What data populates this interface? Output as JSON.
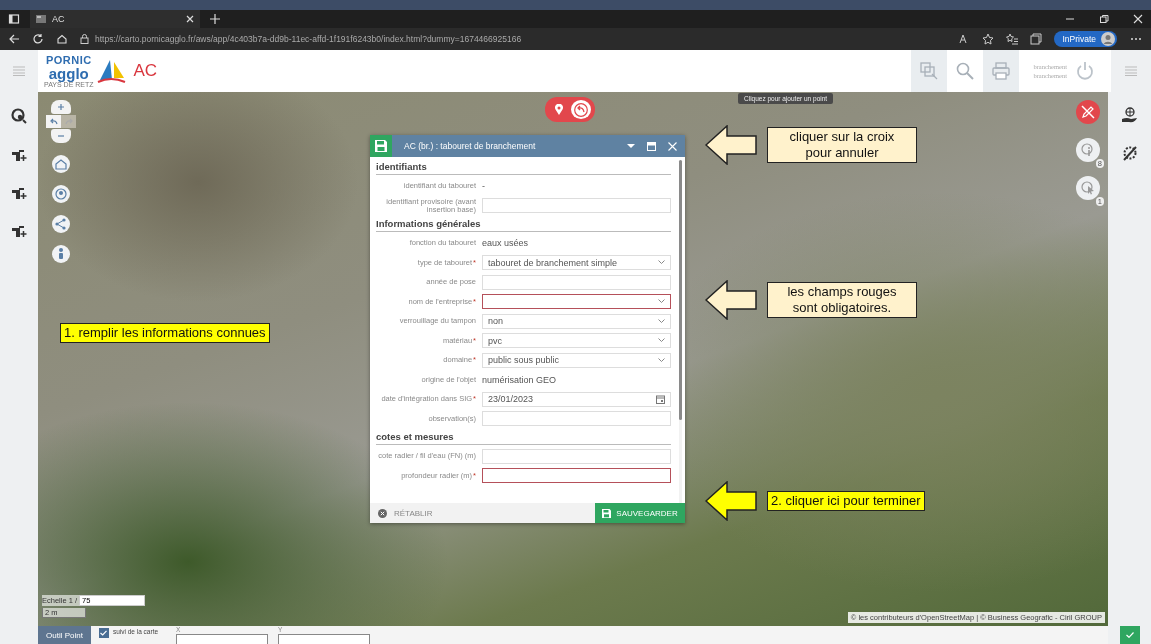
{
  "browser": {
    "tab_title": "AC",
    "url": "https://carto.pornicagglo.fr/aws/app/4c403b7a-dd9b-11ec-affd-1f191f6243b0/index.html?dummy=1674466925166",
    "profile_label": "InPrivate"
  },
  "header": {
    "logo_top": "PORNIC",
    "logo_main": "agglo",
    "logo_sub": "PAYS DE RETZ",
    "app_name": "AC",
    "layer_lines": [
      "branchement",
      "branchement"
    ]
  },
  "map": {
    "tooltip": "Cliquez pour ajouter un point",
    "badges": [
      "8",
      "1"
    ],
    "scale_label": "Echelle 1 /",
    "scale_value": "75",
    "scale_bar": "2 m",
    "attribution": "© les contributeurs d'OpenStreetMap | © Business Geografic - Ciril GROUP"
  },
  "dialog": {
    "title": "AC (br.) : tabouret de branchement",
    "sections": [
      {
        "title": "identifiants",
        "fields": [
          {
            "label": "identifiant du tabouret",
            "kind": "text",
            "value": "-",
            "invalid": false
          },
          {
            "label": "identifiant provisoire (avant insertion base)",
            "kind": "input",
            "invalid": false
          }
        ]
      },
      {
        "title": "Informations générales",
        "fields": [
          {
            "label": "fonction du tabouret",
            "kind": "text",
            "value": "eaux usées",
            "invalid": false
          },
          {
            "label": "type de tabouret",
            "required_mark": "*",
            "kind": "select",
            "value": "tabouret de branchement simple",
            "invalid": false
          },
          {
            "label": "année de pose",
            "kind": "input",
            "invalid": false
          },
          {
            "label": "nom de l'entreprise",
            "required_mark": "*",
            "kind": "select",
            "invalid": true
          },
          {
            "label": "verrouillage du tampon",
            "kind": "select",
            "value": "non",
            "invalid": false
          },
          {
            "label": "matériau",
            "required_mark": "*",
            "kind": "select",
            "value": "pvc",
            "invalid": false
          },
          {
            "label": "domaine",
            "required_mark": "*",
            "kind": "select",
            "value": "public sous public",
            "invalid": false
          },
          {
            "label": "origine de l'objet",
            "kind": "text",
            "value": "numérisation GEO",
            "invalid": false
          },
          {
            "label": "date d'intégration dans SIG",
            "required_mark": "*",
            "kind": "date",
            "value": "23/01/2023",
            "invalid": false
          },
          {
            "label": "observation(s)",
            "kind": "input",
            "invalid": false
          }
        ]
      },
      {
        "title": "cotes et mesures",
        "fields": [
          {
            "label": "cote radier / fil d'eau (FN) (m)",
            "kind": "input",
            "invalid": false
          },
          {
            "label": "profondeur radier (m)",
            "required_mark": "*",
            "kind": "input",
            "invalid": true
          }
        ]
      }
    ],
    "reset_label": "RÉTABLIR",
    "save_label": "SAUVEGARDER"
  },
  "callouts": [
    {
      "kind": "note",
      "arrow": true,
      "text": "cliquer sur la croix\npour annuler"
    },
    {
      "kind": "note",
      "arrow": true,
      "text": "les champs rouges\nsont obligatoires."
    },
    {
      "kind": "instruction",
      "arrow": false,
      "text": "1. remplir les informations connues"
    },
    {
      "kind": "instruction",
      "arrow": true,
      "text": "2. cliquer ici pour terminer"
    }
  ],
  "bottom_bar": {
    "tool": "Outil Point",
    "follow_map": {
      "label": "suivi de la carte",
      "checked": true
    },
    "x_label": "X",
    "y_label": "Y"
  }
}
